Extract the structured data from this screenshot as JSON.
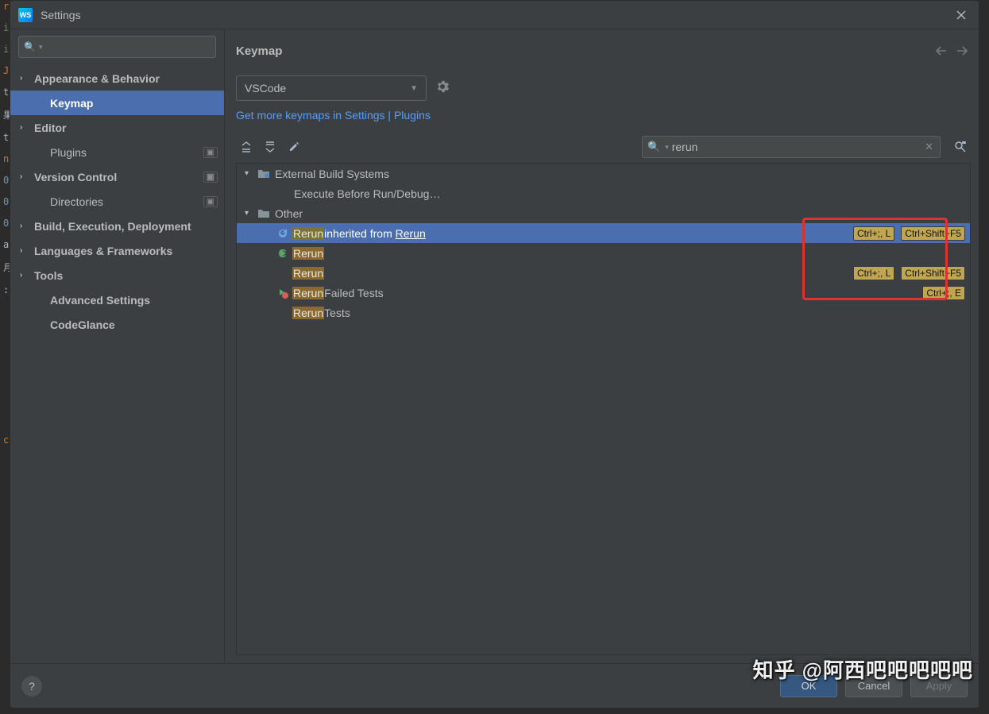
{
  "window": {
    "title": "Settings"
  },
  "sidebar": {
    "search_placeholder": "",
    "items": [
      {
        "label": "Appearance & Behavior",
        "expandable": true,
        "bold": true
      },
      {
        "label": "Keymap",
        "selected": true,
        "indent": true,
        "bold": true
      },
      {
        "label": "Editor",
        "expandable": true,
        "bold": true
      },
      {
        "label": "Plugins",
        "indent": true,
        "badge": "▣"
      },
      {
        "label": "Version Control",
        "expandable": true,
        "bold": true,
        "badge": "▣"
      },
      {
        "label": "Directories",
        "indent": true,
        "badge": "▣"
      },
      {
        "label": "Build, Execution, Deployment",
        "expandable": true,
        "bold": true
      },
      {
        "label": "Languages & Frameworks",
        "expandable": true,
        "bold": true
      },
      {
        "label": "Tools",
        "expandable": true,
        "bold": true
      },
      {
        "label": "Advanced Settings",
        "indent": true,
        "bold": true
      },
      {
        "label": "CodeGlance",
        "indent": true,
        "bold": true
      }
    ]
  },
  "main": {
    "title": "Keymap",
    "keymap_selected": "VSCode",
    "link": "Get more keymaps in Settings | Plugins",
    "search_value": "rerun",
    "tree": {
      "g1": {
        "label": "External Build Systems",
        "child": "Execute Before Run/Debug…"
      },
      "g2": {
        "label": "Other"
      },
      "actions": [
        {
          "name": "Rerun",
          "suffix_inh": " inherited from ",
          "suffix_link": "Rerun",
          "selected": true,
          "icon": "refresh",
          "sc": [
            "Ctrl+;, L",
            "Ctrl+Shift+F5"
          ]
        },
        {
          "name": "Rerun",
          "icon": "rerun-green",
          "sc": []
        },
        {
          "name": "Rerun",
          "icon": "",
          "sc": [
            "Ctrl+;, L",
            "Ctrl+Shift+F5"
          ]
        },
        {
          "name": "Rerun",
          "suffix": " Failed Tests",
          "icon": "rerun-fail",
          "sc": [
            "Ctrl+;, E"
          ],
          "sc_row2": true
        },
        {
          "name": "Rerun",
          "suffix": " Tests",
          "icon": "",
          "sc": []
        }
      ]
    }
  },
  "footer": {
    "ok": "OK",
    "cancel": "Cancel",
    "apply": "Apply"
  },
  "watermark": {
    "zhihu": "知乎",
    "handle": "@阿西吧吧吧吧吧"
  }
}
